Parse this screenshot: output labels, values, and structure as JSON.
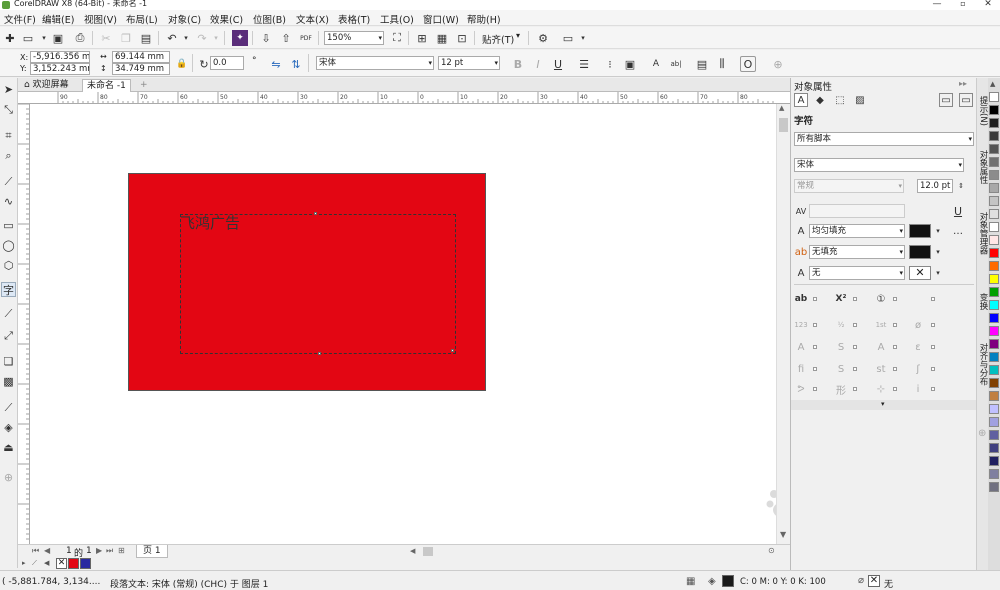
{
  "window": {
    "title": "CorelDRAW X8 (64-Bit) - 未命名 -1"
  },
  "menus": [
    "文件(F)",
    "编辑(E)",
    "视图(V)",
    "布局(L)",
    "对象(C)",
    "效果(C)",
    "位图(B)",
    "文本(X)",
    "表格(T)",
    "工具(O)",
    "窗口(W)",
    "帮助(H)"
  ],
  "toolbar": {
    "zoom": "150%",
    "snap_label": "贴齐(T)",
    "pdf_label": "PDF"
  },
  "property_bar": {
    "x": "-5,916.356 mm",
    "y": "3,152.243 mm",
    "width": "69.144 mm",
    "height": "34.749 mm",
    "angle": "0.0",
    "angle_unit": "°",
    "font": "宋体",
    "size": "12 pt"
  },
  "tabs": {
    "welcome": "欢迎屏幕",
    "doc": "未命名 -1"
  },
  "ruler": {
    "ticks": [
      "90",
      "80",
      "70",
      "60",
      "50",
      "40",
      "30",
      "20",
      "10",
      "0",
      "10",
      "20",
      "30",
      "40",
      "50",
      "60",
      "70",
      "80"
    ]
  },
  "canvas": {
    "text": "飞鸿广告",
    "rect_color": "#e30613"
  },
  "page_nav": {
    "current": "1",
    "of": "的",
    "total": "1",
    "page_tab": "页 1"
  },
  "docker": {
    "title": "对象属性",
    "section": "字符",
    "script": "所有脚本",
    "font": "宋体",
    "style": "常规",
    "size": "12.0 pt",
    "fill": "均匀填充",
    "bg_fill": "无填充",
    "outline": "无"
  },
  "vertical_tabs": [
    "提示(N)",
    "对象属性",
    "对象管理器",
    "变换",
    "对齐与分布"
  ],
  "status": {
    "coords": "( -5,881.784, 3,134....",
    "info": "段落文本: 宋体 (常规) (CHC) 于 图层 1",
    "fill_info": "C: 0 M: 0 Y: 0 K: 100",
    "outline_info": "无"
  },
  "colors": {
    "palette": [
      "#ffffff",
      "#000000",
      "#1e1e1e",
      "#3a3a3a",
      "#555555",
      "#707070",
      "#8c8c8c",
      "#a8a8a8",
      "#c4c4c4",
      "#e0e0e0",
      "#ffffff",
      "#ffe6e6",
      "#ff0000",
      "#ff6a00",
      "#ffff00",
      "#00a000",
      "#00ffff",
      "#0000ff",
      "#ff00ff",
      "#800080",
      "#0080c0",
      "#00c0c0",
      "#804000",
      "#c08040",
      "#c0c0ff",
      "#a0a0e0",
      "#6060a0",
      "#404080",
      "#202060",
      "#8080a0",
      "#707080"
    ],
    "fill_chip": "#e30613",
    "outline_chip": "#2a2aa0"
  }
}
